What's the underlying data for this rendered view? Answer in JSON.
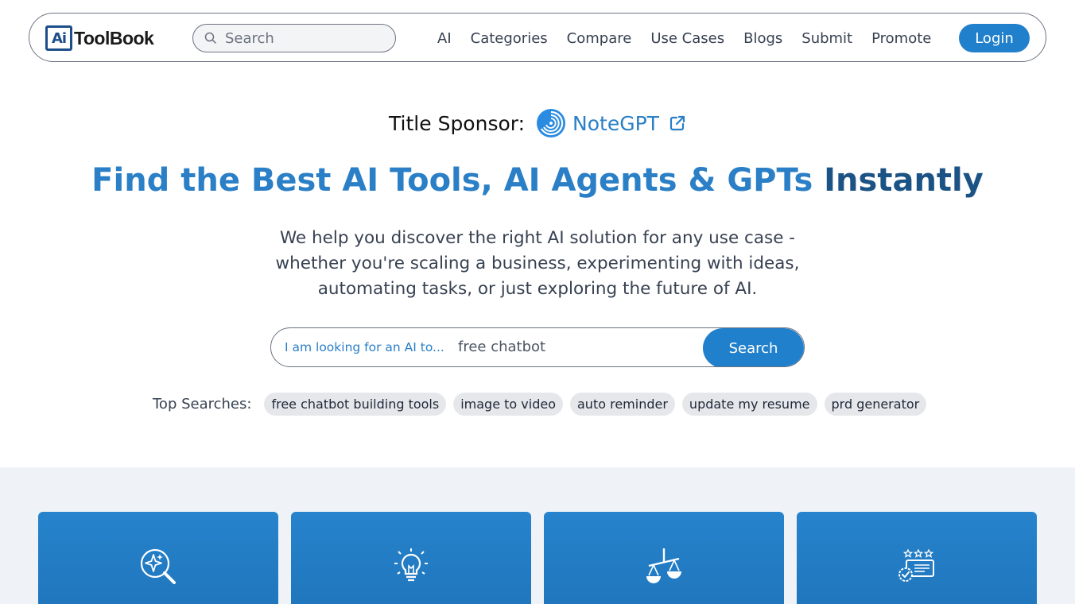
{
  "header": {
    "logo_text": "ToolBook",
    "logo_box_text": "Ai",
    "search_placeholder": "Search",
    "nav": [
      "AI",
      "Categories",
      "Compare",
      "Use Cases",
      "Blogs",
      "Submit",
      "Promote"
    ],
    "login_label": "Login"
  },
  "sponsor": {
    "label": "Title Sponsor:",
    "name": "NoteGPT"
  },
  "hero": {
    "title_part1": "Find the Best AI Tools, AI Agents & GPTs ",
    "title_part2": "Instantly",
    "description": "We help you discover the right AI solution for any use case - whether you're scaling a business, experimenting with ideas, automating tasks, or just exploring the future of AI."
  },
  "main_search": {
    "prefix": "I am looking for an AI to...",
    "value": "free chatbot",
    "button_label": "Search"
  },
  "top_searches": {
    "label": "Top Searches:",
    "items": [
      "free chatbot building tools",
      "image to video",
      "auto reminder",
      "update my resume",
      "prd generator"
    ]
  },
  "cards": [
    {
      "icon": "ai-search-icon"
    },
    {
      "icon": "lightbulb-icon"
    },
    {
      "icon": "compare-scale-icon"
    },
    {
      "icon": "rating-review-icon"
    }
  ],
  "colors": {
    "accent": "#2180cc",
    "title_blue": "#2a7fc6",
    "title_dark": "#1c5385",
    "lower_bg": "#eff3f8"
  }
}
